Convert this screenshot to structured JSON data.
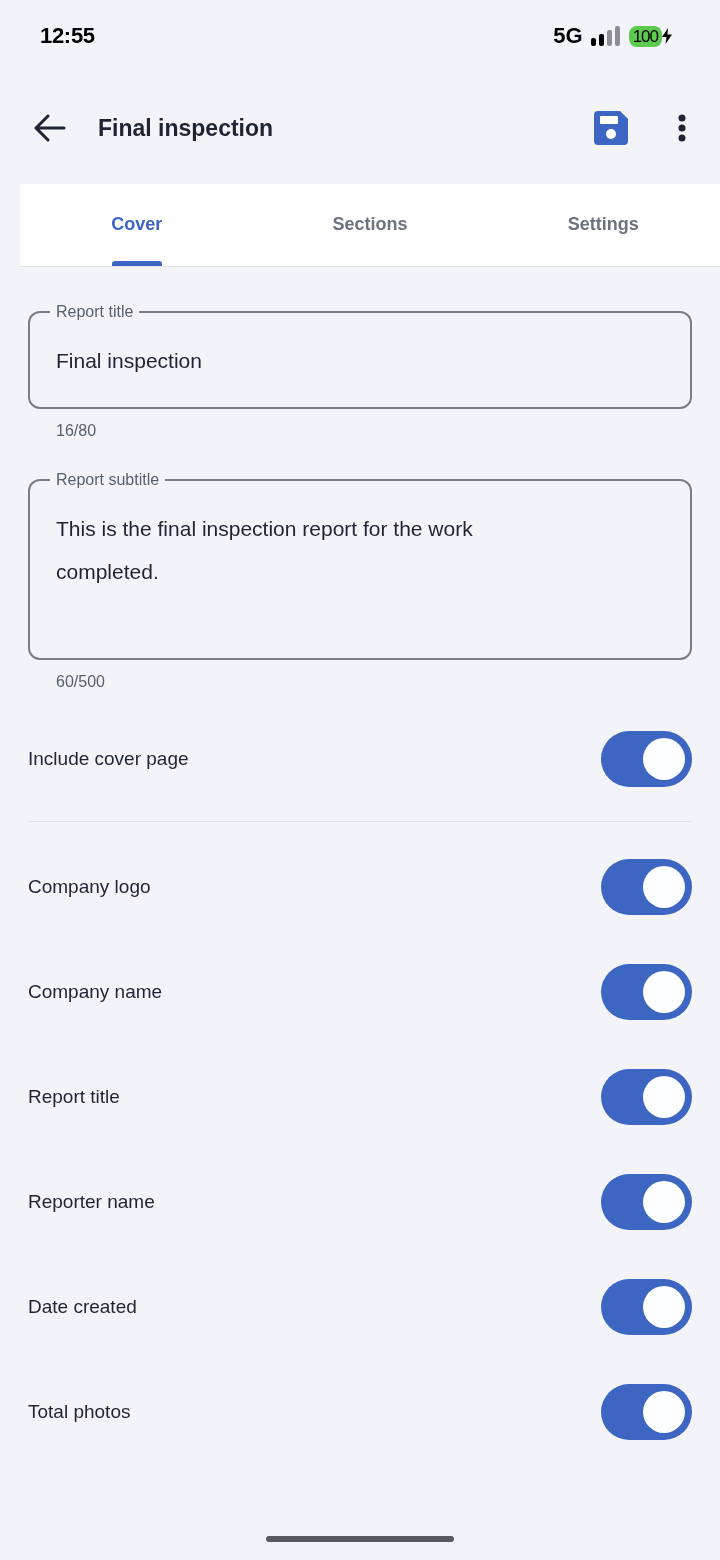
{
  "status_bar": {
    "time": "12:55",
    "network": "5G",
    "battery": "100"
  },
  "header": {
    "title": "Final inspection"
  },
  "tabs": [
    {
      "label": "Cover",
      "selected": true
    },
    {
      "label": "Sections",
      "selected": false
    },
    {
      "label": "Settings",
      "selected": false
    }
  ],
  "fields": [
    {
      "kind": "single",
      "label": "Report title",
      "value": "Final inspection",
      "counter": "16/80"
    },
    {
      "kind": "multiline",
      "label": "Report subtitle",
      "value": "This is the final inspection report for the work completed.",
      "counter": "60/500"
    }
  ],
  "cover_toggle": {
    "label": "Include cover page",
    "on": true
  },
  "cover_items": [
    {
      "label": "Company logo",
      "on": true
    },
    {
      "label": "Company name",
      "on": true
    },
    {
      "label": "Report title",
      "on": true
    },
    {
      "label": "Reporter name",
      "on": true
    },
    {
      "label": "Date created",
      "on": true
    },
    {
      "label": "Total photos",
      "on": true
    }
  ]
}
